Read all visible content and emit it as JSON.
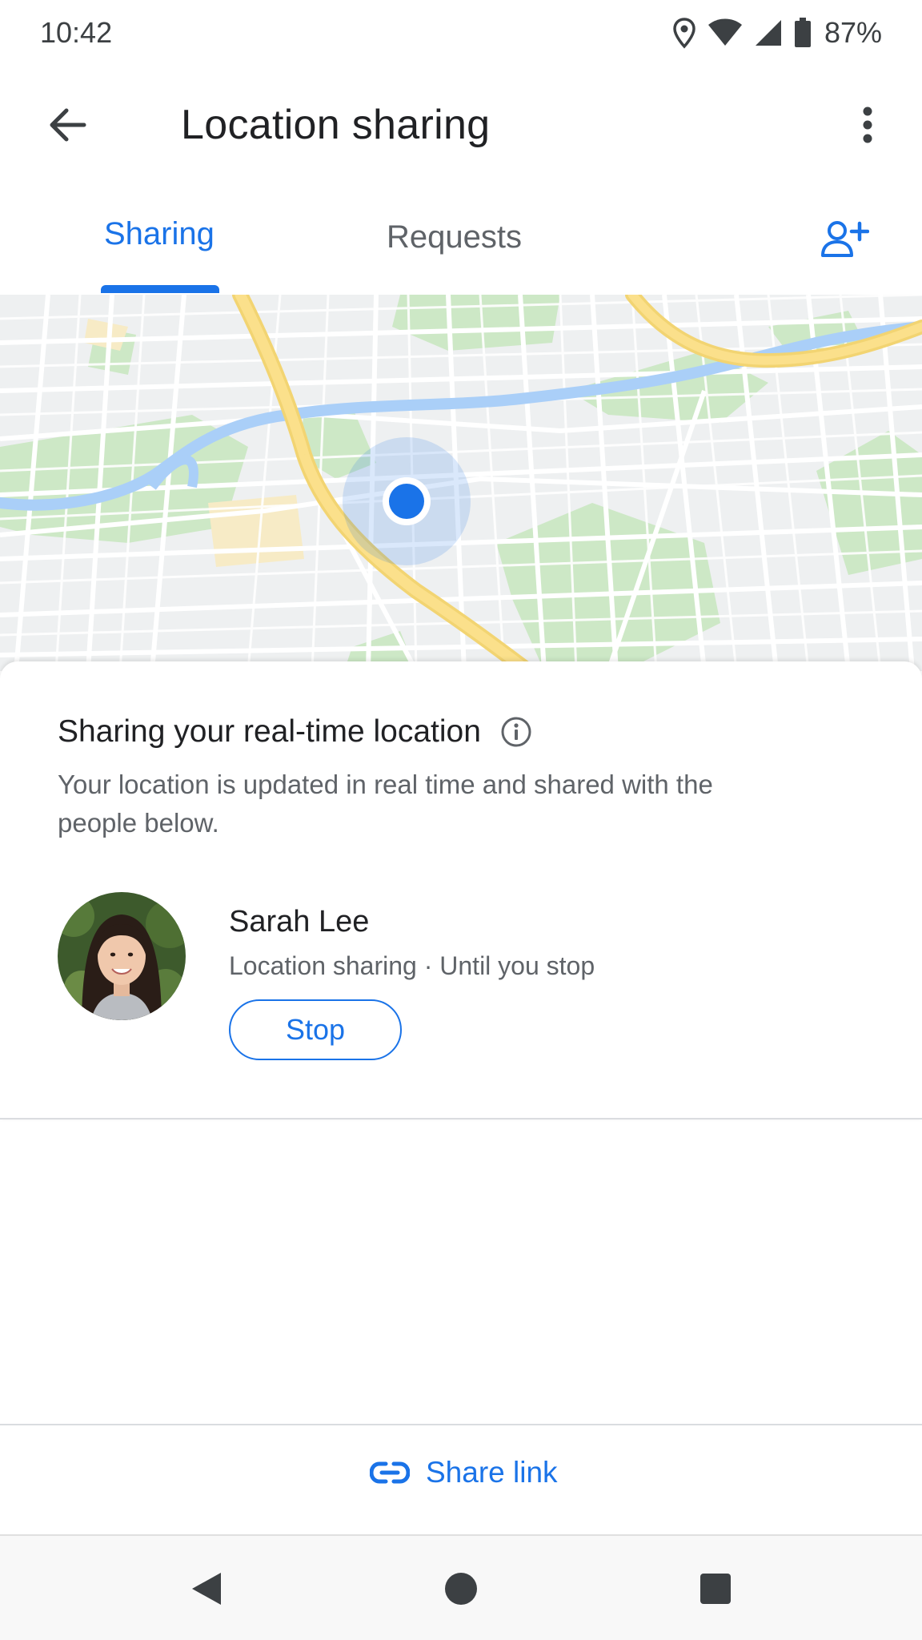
{
  "status_bar": {
    "time": "10:42",
    "battery": "87%",
    "icons": [
      "location-icon",
      "wifi-icon",
      "signal-icon",
      "battery-icon"
    ]
  },
  "app_bar": {
    "title": "Location sharing",
    "back_icon": "arrow-back-icon",
    "overflow_icon": "more-vert-icon"
  },
  "tabs": [
    {
      "label": "Sharing",
      "selected": true
    },
    {
      "label": "Requests",
      "selected": false
    }
  ],
  "add_person_icon": "person-add-icon",
  "colors": {
    "accent": "#1a73e8",
    "text_primary": "#202124",
    "text_secondary": "#5f6368",
    "map_water": "#aacff8",
    "map_road_major": "#fbe08b",
    "map_park": "#cde8c6"
  },
  "card": {
    "title": "Sharing your real-time location",
    "info_icon": "info-icon",
    "description": "Your location is updated in real time and shared with the people below.",
    "contacts": [
      {
        "name": "Sarah Lee",
        "status": "Location sharing · Until you stop",
        "action": "Stop"
      }
    ]
  },
  "share_link": {
    "label": "Share link",
    "icon": "link-icon"
  },
  "nav_bar": {
    "buttons": [
      "nav-back-icon",
      "nav-home-icon",
      "nav-recents-icon"
    ]
  }
}
